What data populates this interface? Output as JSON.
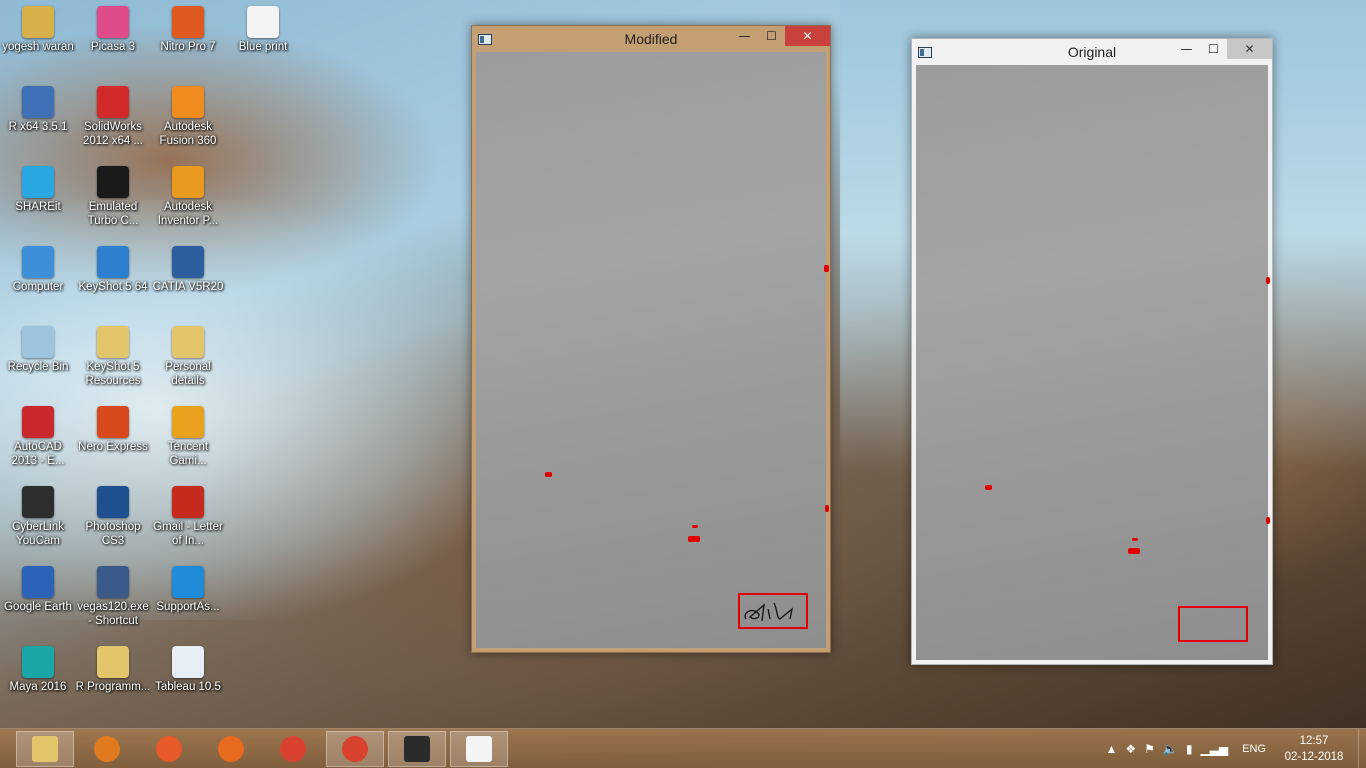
{
  "desktop": {
    "icons": [
      {
        "label": "yogesh waran",
        "icon": "folder-user-icon",
        "color": "#d8b04a"
      },
      {
        "label": "Picasa 3",
        "icon": "picasa-icon",
        "color": "#e04b8a"
      },
      {
        "label": "Nitro Pro 7",
        "icon": "nitro-icon",
        "color": "#e05a1f"
      },
      {
        "label": "Blue print",
        "icon": "document-icon",
        "color": "#f4f4f4"
      },
      {
        "label": "R x64 3.5.1",
        "icon": "r-icon",
        "color": "#3f6fb4"
      },
      {
        "label": "SolidWorks 2012 x64 ...",
        "icon": "solidworks-icon",
        "color": "#d22a2a"
      },
      {
        "label": "Autodesk Fusion 360",
        "icon": "fusion-icon",
        "color": "#f08c1e"
      },
      {
        "label": "SHAREit",
        "icon": "shareit-icon",
        "color": "#2aa6e0"
      },
      {
        "label": "Emulated Turbo C...",
        "icon": "turbo-c-icon",
        "color": "#1a1a1a"
      },
      {
        "label": "Autodesk Inventor P...",
        "icon": "inventor-icon",
        "color": "#e89a1e"
      },
      {
        "label": "Computer",
        "icon": "computer-icon",
        "color": "#3d8fd8"
      },
      {
        "label": "KeyShot 5 64",
        "icon": "keyshot-icon",
        "color": "#2e7fd0"
      },
      {
        "label": "CATIA V5R20",
        "icon": "catia-icon",
        "color": "#2c5ea0"
      },
      {
        "label": "Recycle Bin",
        "icon": "recycle-bin-icon",
        "color": "#9ec3dd"
      },
      {
        "label": "KeyShot 5 Resources",
        "icon": "folder-icon",
        "color": "#e3c56c"
      },
      {
        "label": "Personal details",
        "icon": "folder-icon",
        "color": "#e3c56c"
      },
      {
        "label": "AutoCAD 2013 - E...",
        "icon": "autocad-icon",
        "color": "#c9282d"
      },
      {
        "label": "Nero Express",
        "icon": "nero-icon",
        "color": "#d84a1e"
      },
      {
        "label": "Tencent Gami...",
        "icon": "tencent-icon",
        "color": "#e8a21e"
      },
      {
        "label": "CyberLink YouCam",
        "icon": "youcam-icon",
        "color": "#2d2d2d"
      },
      {
        "label": "Photoshop CS3",
        "icon": "photoshop-icon",
        "color": "#1f4f8f"
      },
      {
        "label": "Gmail - Letter of In...",
        "icon": "pdf-icon",
        "color": "#c42b1c"
      },
      {
        "label": "Google Earth",
        "icon": "google-earth-icon",
        "color": "#2a63b8"
      },
      {
        "label": "vegas120.exe - Shortcut",
        "icon": "vegas-icon",
        "color": "#3a5a8a"
      },
      {
        "label": "SupportAs...",
        "icon": "support-icon",
        "color": "#1f8ad8"
      },
      {
        "label": "Maya 2016",
        "icon": "maya-icon",
        "color": "#1aa6a6"
      },
      {
        "label": "R Programm...",
        "icon": "folder-icon",
        "color": "#e3c56c"
      },
      {
        "label": "Tableau 10.5",
        "icon": "tableau-icon",
        "color": "#e8eef5"
      }
    ]
  },
  "windows": {
    "modified": {
      "title": "Modified",
      "minimize": "—",
      "maximize": "☐",
      "close": "✕"
    },
    "original": {
      "title": "Original",
      "minimize": "—",
      "maximize": "☐",
      "close": "✕"
    }
  },
  "taskbar": {
    "apps": [
      {
        "name": "file-explorer",
        "icon": "folder-icon",
        "color": "#e3c56c",
        "active": true
      },
      {
        "name": "java-app",
        "icon": "java-icon",
        "color": "#e07a1e",
        "active": false
      },
      {
        "name": "gallery-app",
        "icon": "picture-icon",
        "color": "#e85a2a",
        "active": false
      },
      {
        "name": "firefox",
        "icon": "firefox-icon",
        "color": "#e86a1e",
        "active": false
      },
      {
        "name": "chrome",
        "icon": "chrome-icon",
        "color": "#d9412f",
        "active": false
      },
      {
        "name": "chrome-2",
        "icon": "chrome-icon",
        "color": "#d9412f",
        "active": true
      },
      {
        "name": "command-prompt",
        "icon": "terminal-icon",
        "color": "#2b2b2b",
        "active": true
      },
      {
        "name": "notepad",
        "icon": "blank-document-icon",
        "color": "#f4f4f4",
        "active": true
      }
    ],
    "tray": {
      "language": "ENG",
      "time": "12:57",
      "date": "02-12-2018"
    }
  }
}
